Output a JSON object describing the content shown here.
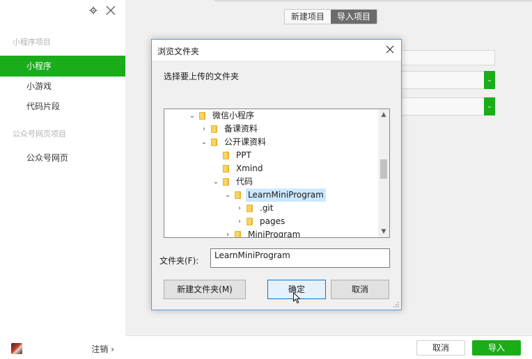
{
  "sidebar": {
    "sections": [
      {
        "title": "小程序项目",
        "items": [
          "小程序",
          "小游戏",
          "代码片段"
        ]
      },
      {
        "title": "公众号网页项目",
        "items": [
          "公众号网页"
        ]
      }
    ],
    "active_item": "小程序",
    "logout_label": "注销 ›"
  },
  "header": {
    "tabs": [
      "新建项目",
      "导入项目"
    ],
    "active_tab": "导入项目"
  },
  "footer": {
    "cancel_label": "取消",
    "import_label": "导入"
  },
  "dialog": {
    "title": "浏览文件夹",
    "prompt": "选择要上传的文件夹",
    "tree": [
      {
        "label": "微信小程序",
        "depth": 0,
        "state": "expanded"
      },
      {
        "label": "备课资料",
        "depth": 1,
        "state": "collapsed"
      },
      {
        "label": "公开课资料",
        "depth": 1,
        "state": "expanded"
      },
      {
        "label": "PPT",
        "depth": 2,
        "state": "leaf"
      },
      {
        "label": "Xmind",
        "depth": 2,
        "state": "leaf"
      },
      {
        "label": "代码",
        "depth": 2,
        "state": "expanded"
      },
      {
        "label": "LearnMiniProgram",
        "depth": 3,
        "state": "expanded",
        "selected": true
      },
      {
        "label": ".git",
        "depth": 4,
        "state": "collapsed"
      },
      {
        "label": "pages",
        "depth": 4,
        "state": "collapsed"
      },
      {
        "label": "MiniProgram",
        "depth": 3,
        "state": "collapsed"
      }
    ],
    "folder_field_label": "文件夹(F):",
    "folder_value": "LearnMiniProgram",
    "new_folder_label": "新建文件夹(M)",
    "ok_label": "确定",
    "cancel_label": "取消"
  },
  "colors": {
    "accent": "#1aad19",
    "selection": "#cce8ff",
    "dialog_border": "#5a9ad8"
  }
}
